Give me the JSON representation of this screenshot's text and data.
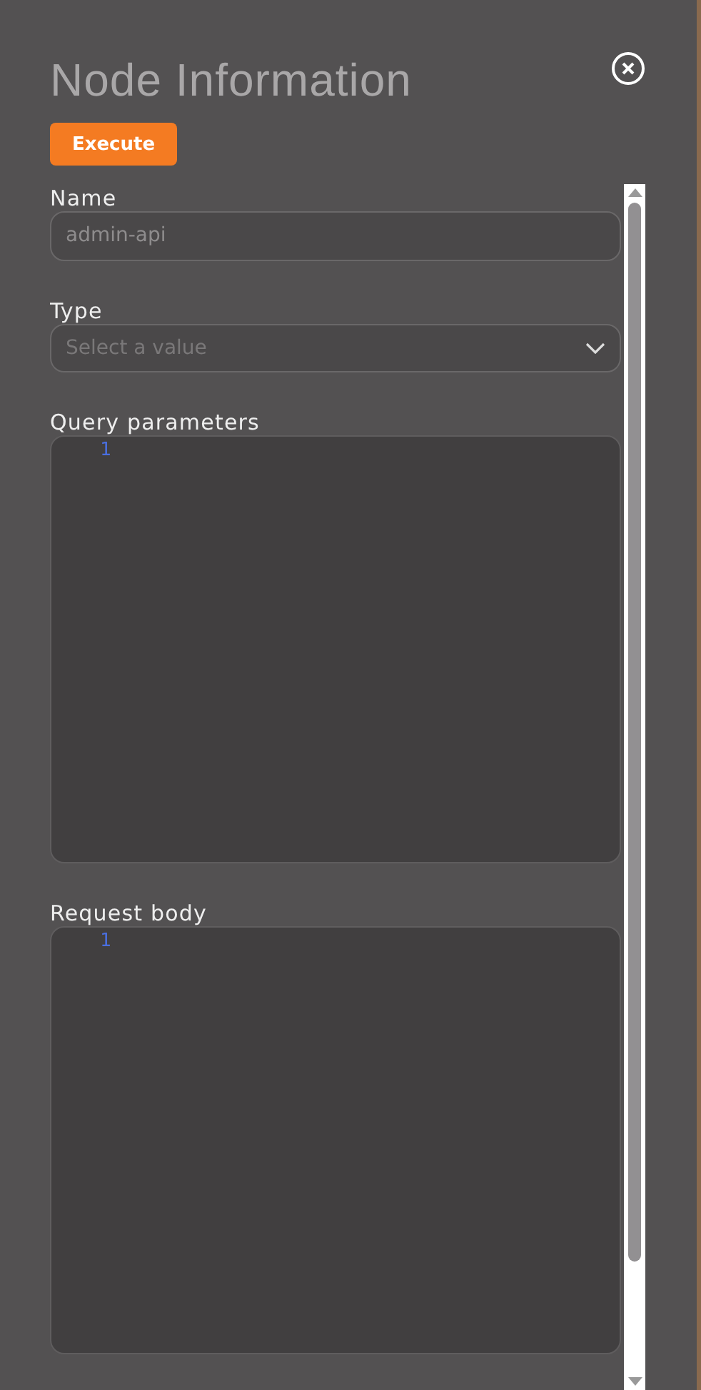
{
  "title": "Node Information",
  "execute_button": "Execute",
  "fields": [
    {
      "kind": "text",
      "label": "Name",
      "value": "admin-api"
    },
    {
      "kind": "select",
      "label": "Type",
      "placeholder": "Select a value"
    },
    {
      "kind": "code",
      "label": "Query parameters",
      "line_numbers": [
        "1"
      ]
    },
    {
      "kind": "code",
      "label": "Request body",
      "line_numbers": [
        "1"
      ]
    }
  ]
}
